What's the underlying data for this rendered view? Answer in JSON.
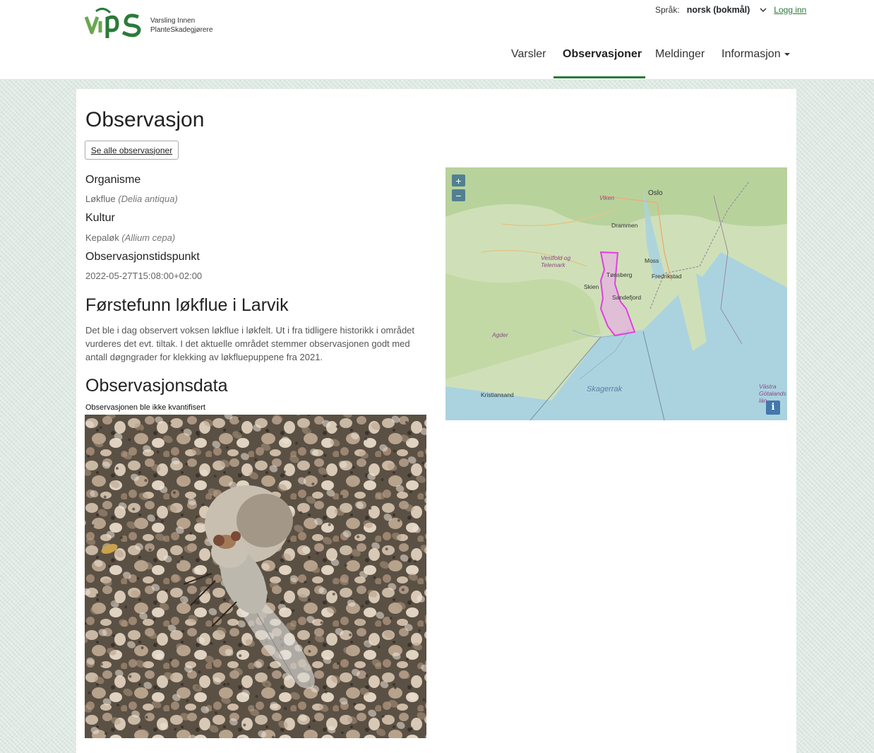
{
  "header": {
    "logo_text": "ViPS",
    "logo_subtitle_line1": "Varsling Innen",
    "logo_subtitle_line2": "PlanteSkadegjørere",
    "language_label": "Språk:",
    "language_value": "norsk (bokmål)",
    "login_label": "Logg inn",
    "nav": [
      {
        "label": "Varsler",
        "active": false
      },
      {
        "label": "Observasjoner",
        "active": true
      },
      {
        "label": "Meldinger",
        "active": false
      },
      {
        "label": "Informasjon",
        "active": false,
        "dropdown": true
      }
    ],
    "accent_color": "#2b7a3a"
  },
  "page": {
    "title": "Observasjon",
    "see_all_button": "Se alle observasjoner",
    "organism_label": "Organisme",
    "organism_name": "Løkflue",
    "organism_latin": "(Delia antiqua)",
    "culture_label": "Kultur",
    "culture_name": "Kepaløk",
    "culture_latin": "(Allium cepa)",
    "time_label": "Observasjonstidspunkt",
    "time_value": "2022-05-27T15:08:00+02:00",
    "observation_title": "Førstefunn løkflue i Larvik",
    "observation_text": "Det ble i dag observert voksen løkflue i løkfelt. Ut i fra tidligere historikk i området vurderes det evt. tiltak. I det aktuelle området stemmer observasjonen godt med antall døgngrader for klekking av løkfluepuppene fra 2021.",
    "data_title": "Observasjonsdata",
    "quantified_text": "Observasjonen ble ikke kvantifisert"
  },
  "map": {
    "zoom_in": "+",
    "zoom_out": "−",
    "info": "i",
    "highlight_color": "#e040e0",
    "places": [
      "Oslo",
      "Viken",
      "Drammen",
      "Vestfold og Telemark",
      "Moss",
      "Tønsberg",
      "Fredrikstad",
      "Skien",
      "Sandefjord",
      "Agder",
      "Kristiansand",
      "Skagerrak",
      "Västra Götalands län"
    ]
  }
}
